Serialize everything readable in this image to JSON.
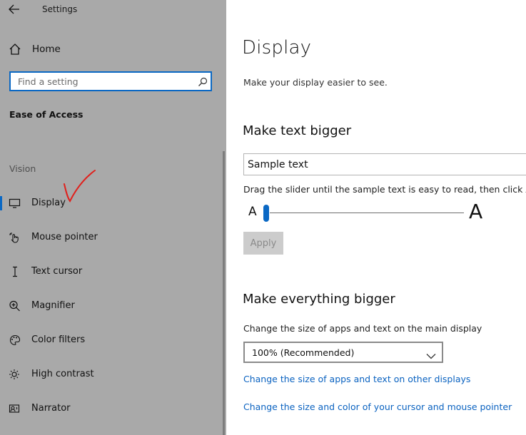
{
  "window": {
    "title": "Settings"
  },
  "sidebar": {
    "home_label": "Home",
    "search_placeholder": "Find a setting",
    "section": "Ease of Access",
    "group": "Vision",
    "items": [
      {
        "label": "Display",
        "icon": "monitor-icon",
        "active": true
      },
      {
        "label": "Mouse pointer",
        "icon": "mouse-pointer-icon"
      },
      {
        "label": "Text cursor",
        "icon": "text-cursor-icon"
      },
      {
        "label": "Magnifier",
        "icon": "magnifier-icon"
      },
      {
        "label": "Color filters",
        "icon": "palette-icon"
      },
      {
        "label": "High contrast",
        "icon": "contrast-icon"
      },
      {
        "label": "Narrator",
        "icon": "narrator-icon"
      }
    ]
  },
  "main": {
    "title": "Display",
    "subtitle": "Make your display easier to see.",
    "text_bigger": {
      "heading": "Make text bigger",
      "sample": "Sample text",
      "instruction": "Drag the slider until the sample text is easy to read, then click Apply",
      "small_a": "A",
      "large_a": "A",
      "slider_value": 0,
      "apply_label": "Apply"
    },
    "everything_bigger": {
      "heading": "Make everything bigger",
      "label": "Change the size of apps and text on the main display",
      "selected": "100% (Recommended)",
      "link_other_displays": "Change the size of apps and text on other displays",
      "link_cursor": "Change the size and color of your cursor and mouse pointer"
    }
  },
  "colors": {
    "accent": "#0a68c4",
    "sidebar_bg": "#a9a9a9",
    "link": "#0a62c0"
  }
}
